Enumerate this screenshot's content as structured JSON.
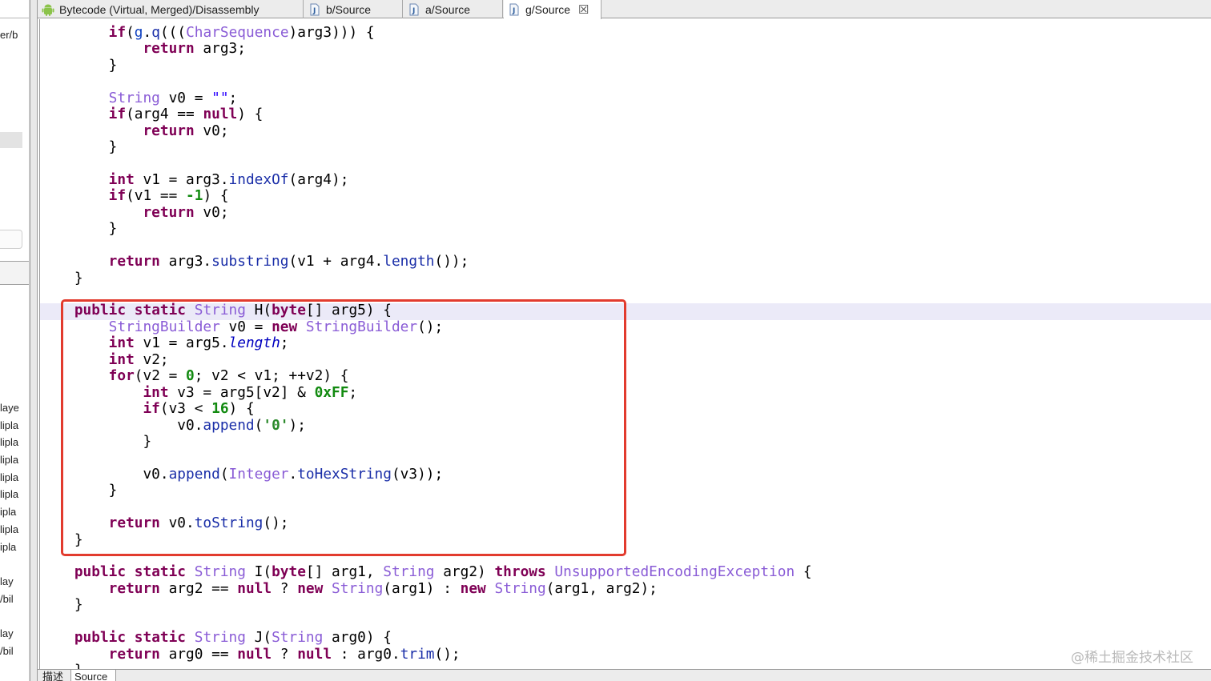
{
  "tabs": [
    {
      "label": "Bytecode (Virtual, Merged)/Disassembly",
      "icon": "android-icon",
      "active": false
    },
    {
      "label": "b/Source",
      "icon": "java-file-icon",
      "active": false
    },
    {
      "label": "a/Source",
      "icon": "java-file-icon",
      "active": false
    },
    {
      "label": "g/Source",
      "icon": "java-file-icon",
      "active": true,
      "close": "☒"
    }
  ],
  "left_panel": {
    "fragments": [
      "er/b",
      "laye",
      "lipla",
      "lipla",
      "lipla",
      "lipla",
      "lipla",
      "ipla",
      "lipla",
      "ipla",
      "lay",
      "/bil",
      "lay",
      "/bil"
    ]
  },
  "bottom_tabs": [
    {
      "label": "描述"
    },
    {
      "label": "Source"
    }
  ],
  "watermark": "@稀土掘金技术社区",
  "code_lines": [
    [
      [
        "        ",
        ""
      ],
      [
        "if",
        "kw"
      ],
      [
        "(",
        ""
      ],
      [
        "g",
        "ref"
      ],
      [
        ".",
        ""
      ],
      [
        "q",
        "mt"
      ],
      [
        "(((",
        ""
      ],
      [
        "CharSequence",
        "ty"
      ],
      [
        ")arg3))) {",
        ""
      ]
    ],
    [
      [
        "            ",
        ""
      ],
      [
        "return",
        "kw"
      ],
      [
        " arg3;",
        ""
      ]
    ],
    [
      [
        "        }",
        ""
      ]
    ],
    [
      [
        "",
        ""
      ]
    ],
    [
      [
        "        ",
        ""
      ],
      [
        "String",
        "ty"
      ],
      [
        " v0 = ",
        ""
      ],
      [
        "\"\"",
        "str"
      ],
      [
        ";",
        ""
      ]
    ],
    [
      [
        "        ",
        ""
      ],
      [
        "if",
        "kw"
      ],
      [
        "(arg4 == ",
        ""
      ],
      [
        "null",
        "kw"
      ],
      [
        ") {",
        ""
      ]
    ],
    [
      [
        "            ",
        ""
      ],
      [
        "return",
        "kw"
      ],
      [
        " v0;",
        ""
      ]
    ],
    [
      [
        "        }",
        ""
      ]
    ],
    [
      [
        "",
        ""
      ]
    ],
    [
      [
        "        ",
        ""
      ],
      [
        "int",
        "kw"
      ],
      [
        " v1 = arg3.",
        ""
      ],
      [
        "indexOf",
        "mt"
      ],
      [
        "(arg4);",
        ""
      ]
    ],
    [
      [
        "        ",
        ""
      ],
      [
        "if",
        "kw"
      ],
      [
        "(v1 == ",
        ""
      ],
      [
        "-1",
        "num"
      ],
      [
        ") {",
        ""
      ]
    ],
    [
      [
        "            ",
        ""
      ],
      [
        "return",
        "kw"
      ],
      [
        " v0;",
        ""
      ]
    ],
    [
      [
        "        }",
        ""
      ]
    ],
    [
      [
        "",
        ""
      ]
    ],
    [
      [
        "        ",
        ""
      ],
      [
        "return",
        "kw"
      ],
      [
        " arg3.",
        ""
      ],
      [
        "substring",
        "mt"
      ],
      [
        "(v1 + arg4.",
        ""
      ],
      [
        "length",
        "mt"
      ],
      [
        "());",
        ""
      ]
    ],
    [
      [
        "    }",
        ""
      ]
    ],
    [
      [
        "",
        ""
      ]
    ],
    [
      [
        "    ",
        ""
      ],
      [
        "public",
        "kw"
      ],
      [
        " ",
        ""
      ],
      [
        "static",
        "kw"
      ],
      [
        " ",
        ""
      ],
      [
        "String",
        "ty"
      ],
      [
        " H(",
        ""
      ],
      [
        "byte",
        "kw"
      ],
      [
        "[] arg5) {",
        ""
      ]
    ],
    [
      [
        "        ",
        ""
      ],
      [
        "StringBuilder",
        "ty"
      ],
      [
        " v0 = ",
        ""
      ],
      [
        "new",
        "kw"
      ],
      [
        " ",
        ""
      ],
      [
        "StringBuilder",
        "ty"
      ],
      [
        "();",
        ""
      ]
    ],
    [
      [
        "        ",
        ""
      ],
      [
        "int",
        "kw"
      ],
      [
        " v1 = arg5.",
        ""
      ],
      [
        "length",
        "fld"
      ],
      [
        ";",
        ""
      ]
    ],
    [
      [
        "        ",
        ""
      ],
      [
        "int",
        "kw"
      ],
      [
        " v2;",
        ""
      ]
    ],
    [
      [
        "        ",
        ""
      ],
      [
        "for",
        "kw"
      ],
      [
        "(v2 = ",
        ""
      ],
      [
        "0",
        "num"
      ],
      [
        "; v2 < v1; ++v2) {",
        ""
      ]
    ],
    [
      [
        "            ",
        ""
      ],
      [
        "int",
        "kw"
      ],
      [
        " v3 = arg5[v2] & ",
        ""
      ],
      [
        "0xFF",
        "num"
      ],
      [
        ";",
        ""
      ]
    ],
    [
      [
        "            ",
        ""
      ],
      [
        "if",
        "kw"
      ],
      [
        "(v3 < ",
        ""
      ],
      [
        "16",
        "num"
      ],
      [
        ") {",
        ""
      ]
    ],
    [
      [
        "                v0.",
        ""
      ],
      [
        "append",
        "mt"
      ],
      [
        "(",
        ""
      ],
      [
        "'0'",
        "chr"
      ],
      [
        ");",
        ""
      ]
    ],
    [
      [
        "            }",
        ""
      ]
    ],
    [
      [
        "",
        ""
      ]
    ],
    [
      [
        "            v0.",
        ""
      ],
      [
        "append",
        "mt"
      ],
      [
        "(",
        ""
      ],
      [
        "Integer",
        "ty"
      ],
      [
        ".",
        ""
      ],
      [
        "toHexString",
        "mt"
      ],
      [
        "(v3));",
        ""
      ]
    ],
    [
      [
        "        }",
        ""
      ]
    ],
    [
      [
        "",
        ""
      ]
    ],
    [
      [
        "        ",
        ""
      ],
      [
        "return",
        "kw"
      ],
      [
        " v0.",
        ""
      ],
      [
        "toString",
        "mt"
      ],
      [
        "();",
        ""
      ]
    ],
    [
      [
        "    }",
        ""
      ]
    ],
    [
      [
        "",
        ""
      ]
    ],
    [
      [
        "    ",
        ""
      ],
      [
        "public",
        "kw"
      ],
      [
        " ",
        ""
      ],
      [
        "static",
        "kw"
      ],
      [
        " ",
        ""
      ],
      [
        "String",
        "ty"
      ],
      [
        " I(",
        ""
      ],
      [
        "byte",
        "kw"
      ],
      [
        "[] arg1, ",
        ""
      ],
      [
        "String",
        "ty"
      ],
      [
        " arg2) ",
        ""
      ],
      [
        "throws",
        "kw"
      ],
      [
        " ",
        ""
      ],
      [
        "UnsupportedEncodingException",
        "ty"
      ],
      [
        " {",
        ""
      ]
    ],
    [
      [
        "        ",
        ""
      ],
      [
        "return",
        "kw"
      ],
      [
        " arg2 == ",
        ""
      ],
      [
        "null",
        "kw"
      ],
      [
        " ? ",
        ""
      ],
      [
        "new",
        "kw"
      ],
      [
        " ",
        ""
      ],
      [
        "String",
        "ty"
      ],
      [
        "(arg1) : ",
        ""
      ],
      [
        "new",
        "kw"
      ],
      [
        " ",
        ""
      ],
      [
        "String",
        "ty"
      ],
      [
        "(arg1, arg2);",
        ""
      ]
    ],
    [
      [
        "    }",
        ""
      ]
    ],
    [
      [
        "",
        ""
      ]
    ],
    [
      [
        "    ",
        ""
      ],
      [
        "public",
        "kw"
      ],
      [
        " ",
        ""
      ],
      [
        "static",
        "kw"
      ],
      [
        " ",
        ""
      ],
      [
        "String",
        "ty"
      ],
      [
        " J(",
        ""
      ],
      [
        "String",
        "ty"
      ],
      [
        " arg0) {",
        ""
      ]
    ],
    [
      [
        "        ",
        ""
      ],
      [
        "return",
        "kw"
      ],
      [
        " arg0 == ",
        ""
      ],
      [
        "null",
        "kw"
      ],
      [
        " ? ",
        ""
      ],
      [
        "null",
        "kw"
      ],
      [
        " : arg0.",
        ""
      ],
      [
        "trim",
        "mt"
      ],
      [
        "();",
        ""
      ]
    ],
    [
      [
        "    ",
        ""
      ],
      [
        "}",
        ""
      ]
    ]
  ],
  "colors": {
    "keyword": "#7f0055",
    "type": "#8a5cd6",
    "method": "#1a2ea8",
    "number": "#128a10",
    "highlight_box": "#e23b2e",
    "current_line": "#ebeaf8"
  }
}
